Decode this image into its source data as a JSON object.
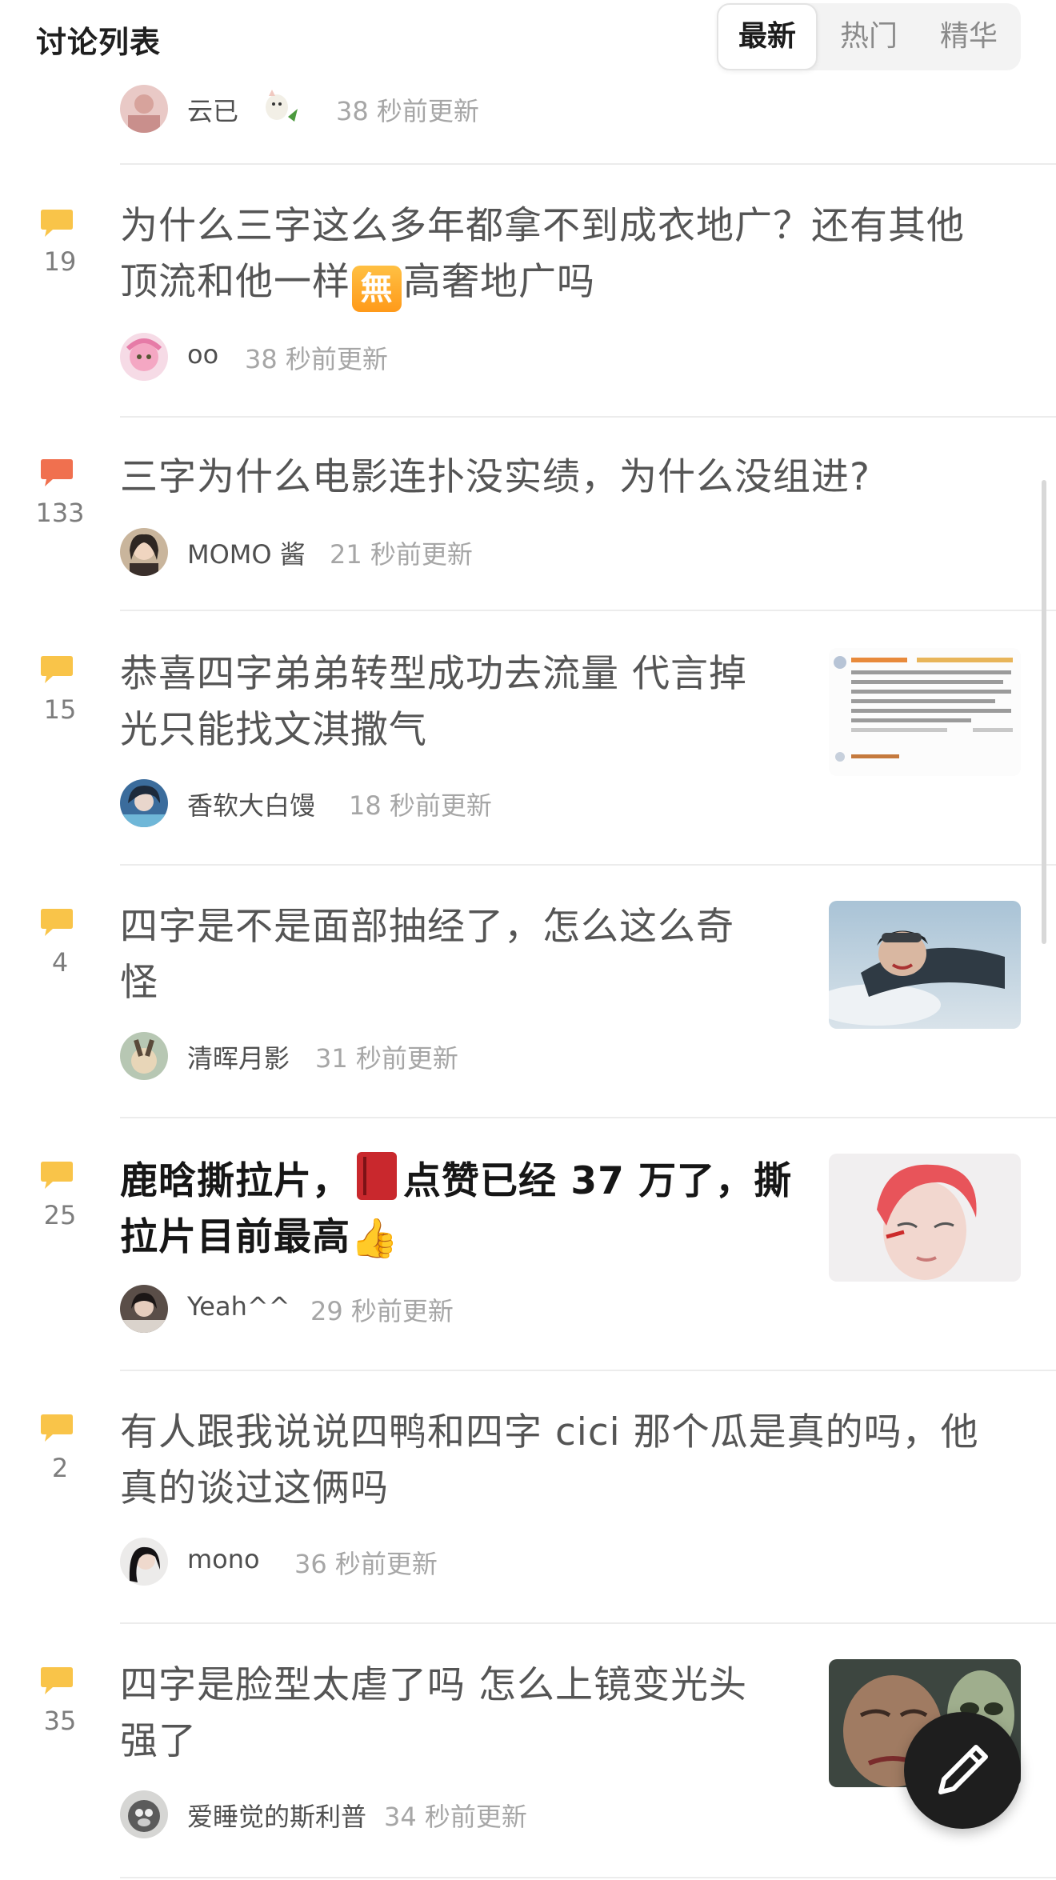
{
  "header": {
    "title": "讨论列表",
    "tabs": [
      {
        "label": "最新",
        "active": true
      },
      {
        "label": "热门",
        "active": false
      },
      {
        "label": "精华",
        "active": false
      }
    ]
  },
  "partial_row": {
    "author": "云已",
    "time": "38 秒前更新"
  },
  "topics": [
    {
      "count": "19",
      "bubble_color": "#f9c449",
      "title_lines": [
        "为什么三字这么多年都拿不到成衣地广？还有其他",
        "顶流和他一样",
        "高奢地广吗"
      ],
      "emoji_badge": "無",
      "author": "oo",
      "time": "38 秒前更新"
    },
    {
      "count": "133",
      "bubble_color": "#f0704f",
      "title_lines": [
        "三字为什么电影连扑没实绩，为什么没组进?"
      ],
      "author": "MOMO 酱",
      "time": "21 秒前更新"
    },
    {
      "count": "15",
      "bubble_color": "#f9c449",
      "title_lines": [
        "恭喜四字弟弟转型成功去流量 代言掉",
        "光只能找文淇撒气"
      ],
      "author": "香软大白馒",
      "time": "18 秒前更新",
      "thumbnail": "screenshot-of-comments"
    },
    {
      "count": "4",
      "bubble_color": "#f9c449",
      "title_lines": [
        "四字是不是面部抽经了，怎么这么奇",
        "怪"
      ],
      "author": "清晖月影",
      "time": "31 秒前更新",
      "thumbnail": "skydiver-photo"
    },
    {
      "count": "25",
      "bubble_color": "#f9c449",
      "title_lines": [
        "鹿晗撕拉片，",
        "点赞已经 37 万了，撕",
        "拉片目前最高"
      ],
      "emoji_thumb": "👍",
      "author": "Yeah^^",
      "time": "29 秒前更新",
      "thumbnail": "red-hair-portrait"
    },
    {
      "count": "2",
      "bubble_color": "#f9c449",
      "title_lines": [
        "有人跟我说说四鸭和四字 cici 那个瓜是真的吗，他",
        "真的谈过这俩吗"
      ],
      "author": "mono",
      "time": "36 秒前更新"
    },
    {
      "count": "35",
      "bubble_color": "#f9c449",
      "title_lines": [
        "四字是脸型太虐了吗  怎么上镜变光头",
        "强了"
      ],
      "author": "爱睡觉的斯利普",
      "time": "34 秒前更新",
      "thumbnail": "bald-character-photo"
    }
  ],
  "fab": {
    "icon": "pen-icon"
  }
}
